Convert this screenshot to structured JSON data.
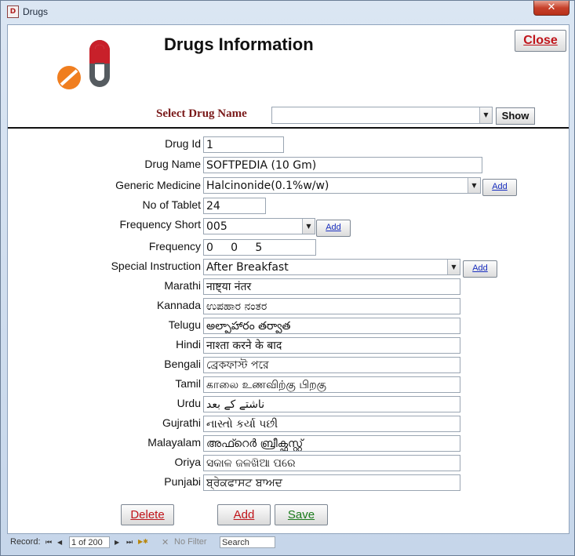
{
  "window": {
    "title": "Drugs",
    "app_icon_glyph": "D",
    "close_glyph": "✕"
  },
  "header": {
    "title": "Drugs Information",
    "close_label": "Close"
  },
  "selector": {
    "label": "Select Drug Name",
    "value": "",
    "show_label": "Show"
  },
  "fields": {
    "drug_id": {
      "label": "Drug Id",
      "value": "1"
    },
    "drug_name": {
      "label": "Drug Name",
      "value": "SOFTPEDIA (10 Gm)"
    },
    "generic_medicine": {
      "label": "Generic Medicine",
      "value": "Halcinonide(0.1%w/w)",
      "add_label": "Add"
    },
    "no_of_tablet": {
      "label": "No of Tablet",
      "value": "24"
    },
    "frequency_short": {
      "label": "Frequency Short",
      "value": "005",
      "add_label": "Add"
    },
    "frequency": {
      "label": "Frequency",
      "value": "0     0     5"
    },
    "special_instruction": {
      "label": "Special Instruction",
      "value": "After Breakfast",
      "add_label": "Add"
    }
  },
  "translations": [
    {
      "label": "Marathi",
      "value": "नाष्ट्या नंतर"
    },
    {
      "label": "Kannada",
      "value": "ಉಪಹಾರ ನಂತರ"
    },
    {
      "label": "Telugu",
      "value": "అల్పాహారం తర్వాత"
    },
    {
      "label": "Hindi",
      "value": "नाश्ता करने के बाद"
    },
    {
      "label": "Bengali",
      "value": "ব্রেকফাস্ট পরে"
    },
    {
      "label": "Tamil",
      "value": "காலை உணவிற்கு பிறகு"
    },
    {
      "label": "Urdu",
      "value": "ناشتے کے بعد"
    },
    {
      "label": "Gujrathi",
      "value": "નાસ્તો કર્યા પછી"
    },
    {
      "label": "Malayalam",
      "value": "അഫ്റെർ ബ്രീക്ഫസ്റ്റ്"
    },
    {
      "label": "Oriya",
      "value": "ସକାଳ ଜଳଖିଆ ପରେ"
    },
    {
      "label": "Punjabi",
      "value": "ਬ੍ਰੇਕਫਾਸਟ ਬਾਅਦ"
    }
  ],
  "actions": {
    "delete_label": "Delete",
    "add_label": "Add",
    "save_label": "Save"
  },
  "statusbar": {
    "record_label": "Record:",
    "first": "⏮",
    "prev": "◀",
    "record_position": "1 of 200",
    "next": "▶",
    "last": "⏭",
    "new": "▶✱",
    "filter_label": "No Filter",
    "search_label": "Search"
  },
  "colors": {
    "close_text": "#c0141a",
    "select_label": "#7a1a1a",
    "delete_text": "#c0141a",
    "add_text": "#c0141a",
    "save_text": "#1a7a1a",
    "link_blue": "#1a2fbf"
  }
}
